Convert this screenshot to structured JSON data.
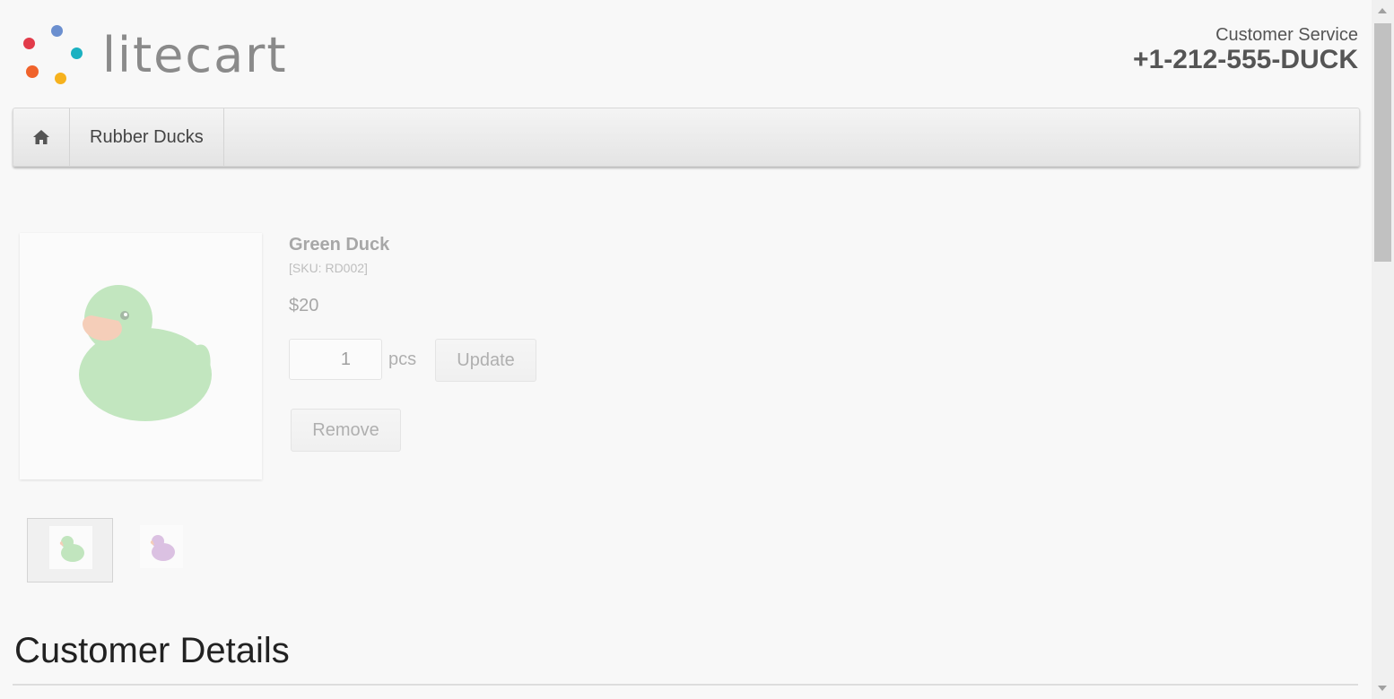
{
  "header": {
    "logo_text": "litecart",
    "logo_dot_colors": [
      "#e23b4a",
      "#6b8fcf",
      "#1bb1c1",
      "#f0632b",
      "#f6b21e"
    ],
    "customer_service_label": "Customer Service",
    "phone": "+1-212-555-DUCK"
  },
  "nav": {
    "home_icon": "home-icon",
    "items": [
      {
        "label": "Rubber Ducks"
      }
    ]
  },
  "cart_item": {
    "name": "Green Duck",
    "sku": "[SKU: RD002]",
    "price": "$20",
    "quantity": "1",
    "unit": "pcs",
    "update_label": "Update",
    "remove_label": "Remove",
    "image_color": "#7fd07a"
  },
  "thumbnails": [
    {
      "name": "green-duck",
      "color": "#7fd07a",
      "active": true
    },
    {
      "name": "purple-duck",
      "color": "#b97fc9",
      "active": false
    }
  ],
  "customer_section": {
    "title": "Customer Details"
  }
}
